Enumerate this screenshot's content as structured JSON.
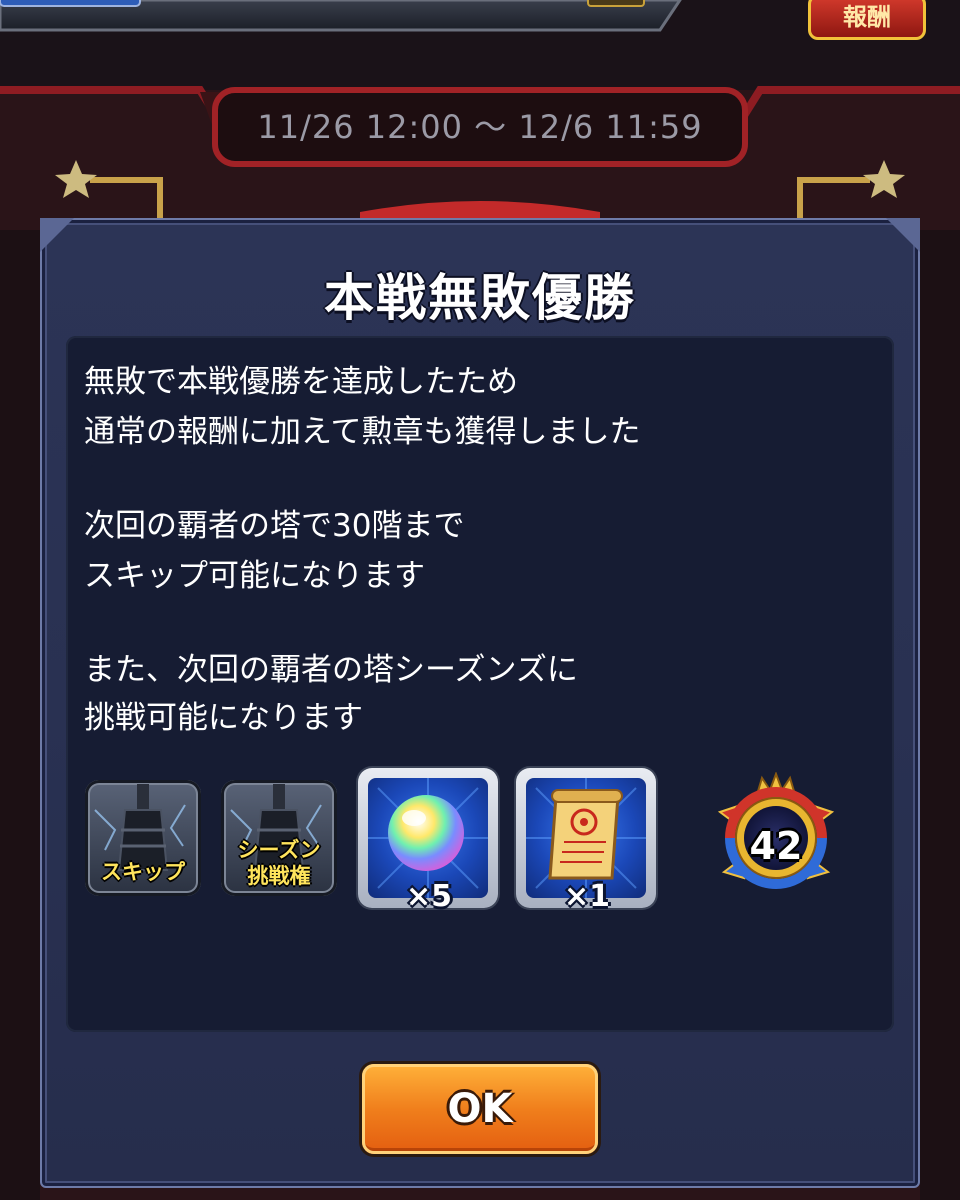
{
  "event_period": "11/26 12:00 〜 12/6 11:59",
  "header_badge": "報酬",
  "dialog": {
    "title": "本戦無敗優勝",
    "message_lines": [
      "無敗で本戦優勝を達成したため",
      "通常の報酬に加えて勲章も獲得しました",
      "次回の覇者の塔で30階まで",
      "スキップ可能になります",
      "また、次回の覇者の塔シーズンズに",
      "挑戦可能になります"
    ],
    "rewards": [
      {
        "icon": "tower-skip-icon",
        "label": "スキップ"
      },
      {
        "icon": "tower-season-icon",
        "label_line1": "シーズン",
        "label_line2": "挑戦権"
      },
      {
        "icon": "rainbow-orb-icon",
        "quantity": "×5"
      },
      {
        "icon": "scroll-icon",
        "quantity": "×1"
      },
      {
        "icon": "medal-icon",
        "value": "42"
      }
    ],
    "ok_label": "OK"
  },
  "colors": {
    "dialog_bg": "#293152",
    "content_bg": "#161c33",
    "button_orange": "#f07f1c",
    "accent_gold": "#e8b630",
    "medal_red": "#d0342a",
    "medal_blue": "#2f6bd8"
  }
}
